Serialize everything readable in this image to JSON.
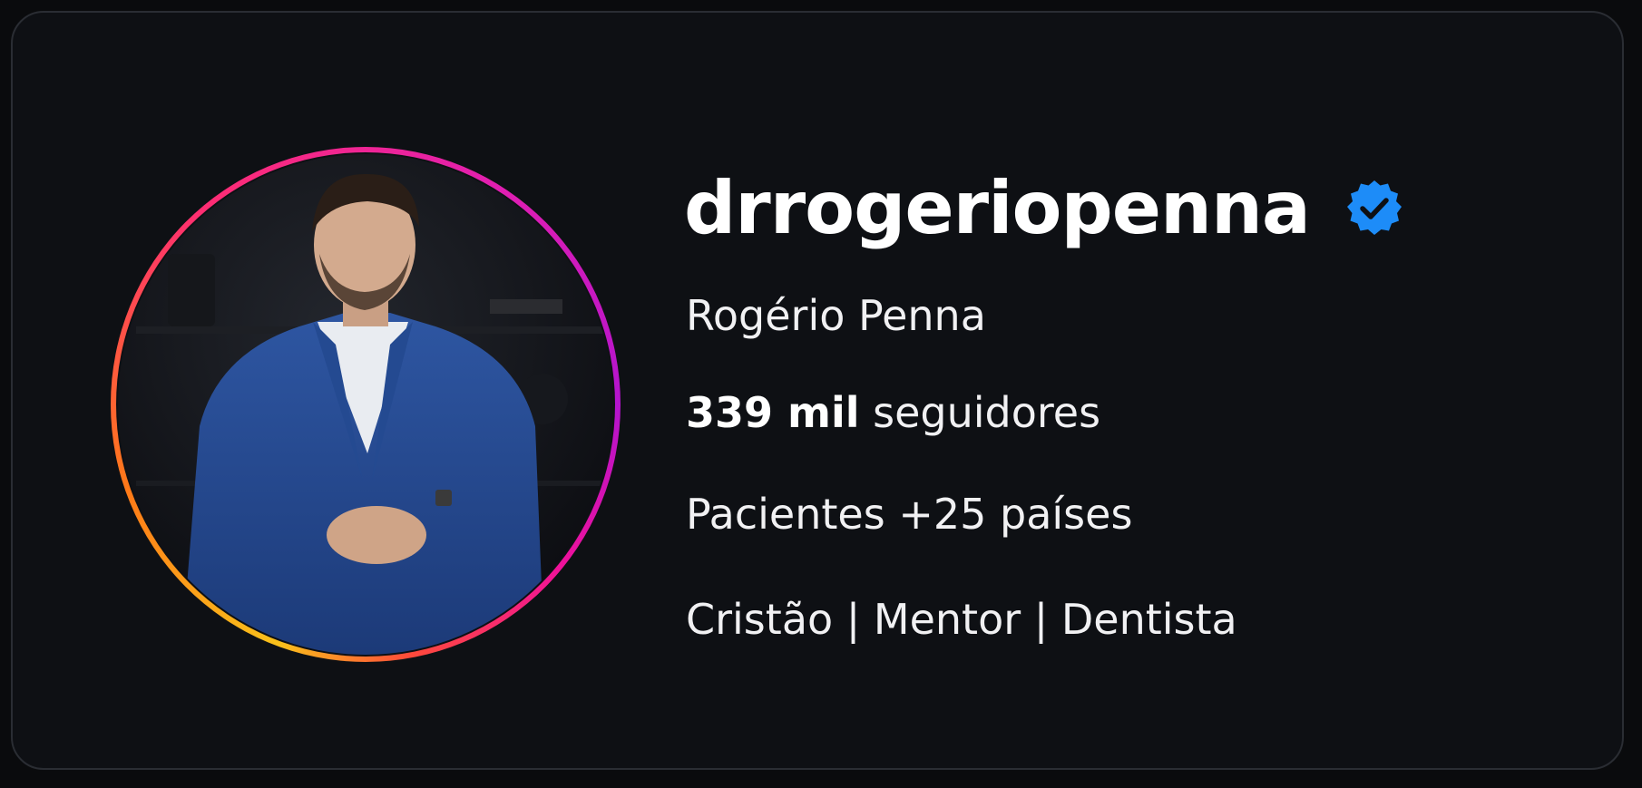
{
  "profile": {
    "username": "drrogeriopenna",
    "verified": true,
    "verified_icon": "verified-badge-icon",
    "full_name": "Rogério Penna",
    "followers_count": "339 mil",
    "followers_label": "seguidores",
    "bio": [
      "Pacientes +25 países",
      "Cristão | Mentor | Dentista"
    ]
  },
  "colors": {
    "background": "#0e1014",
    "verified_blue": "#1d8cf8",
    "text": "#ffffff",
    "story_ring": [
      "#f9c11b",
      "#ff7a18",
      "#ff2d72",
      "#e21fb0",
      "#b414ce"
    ]
  }
}
